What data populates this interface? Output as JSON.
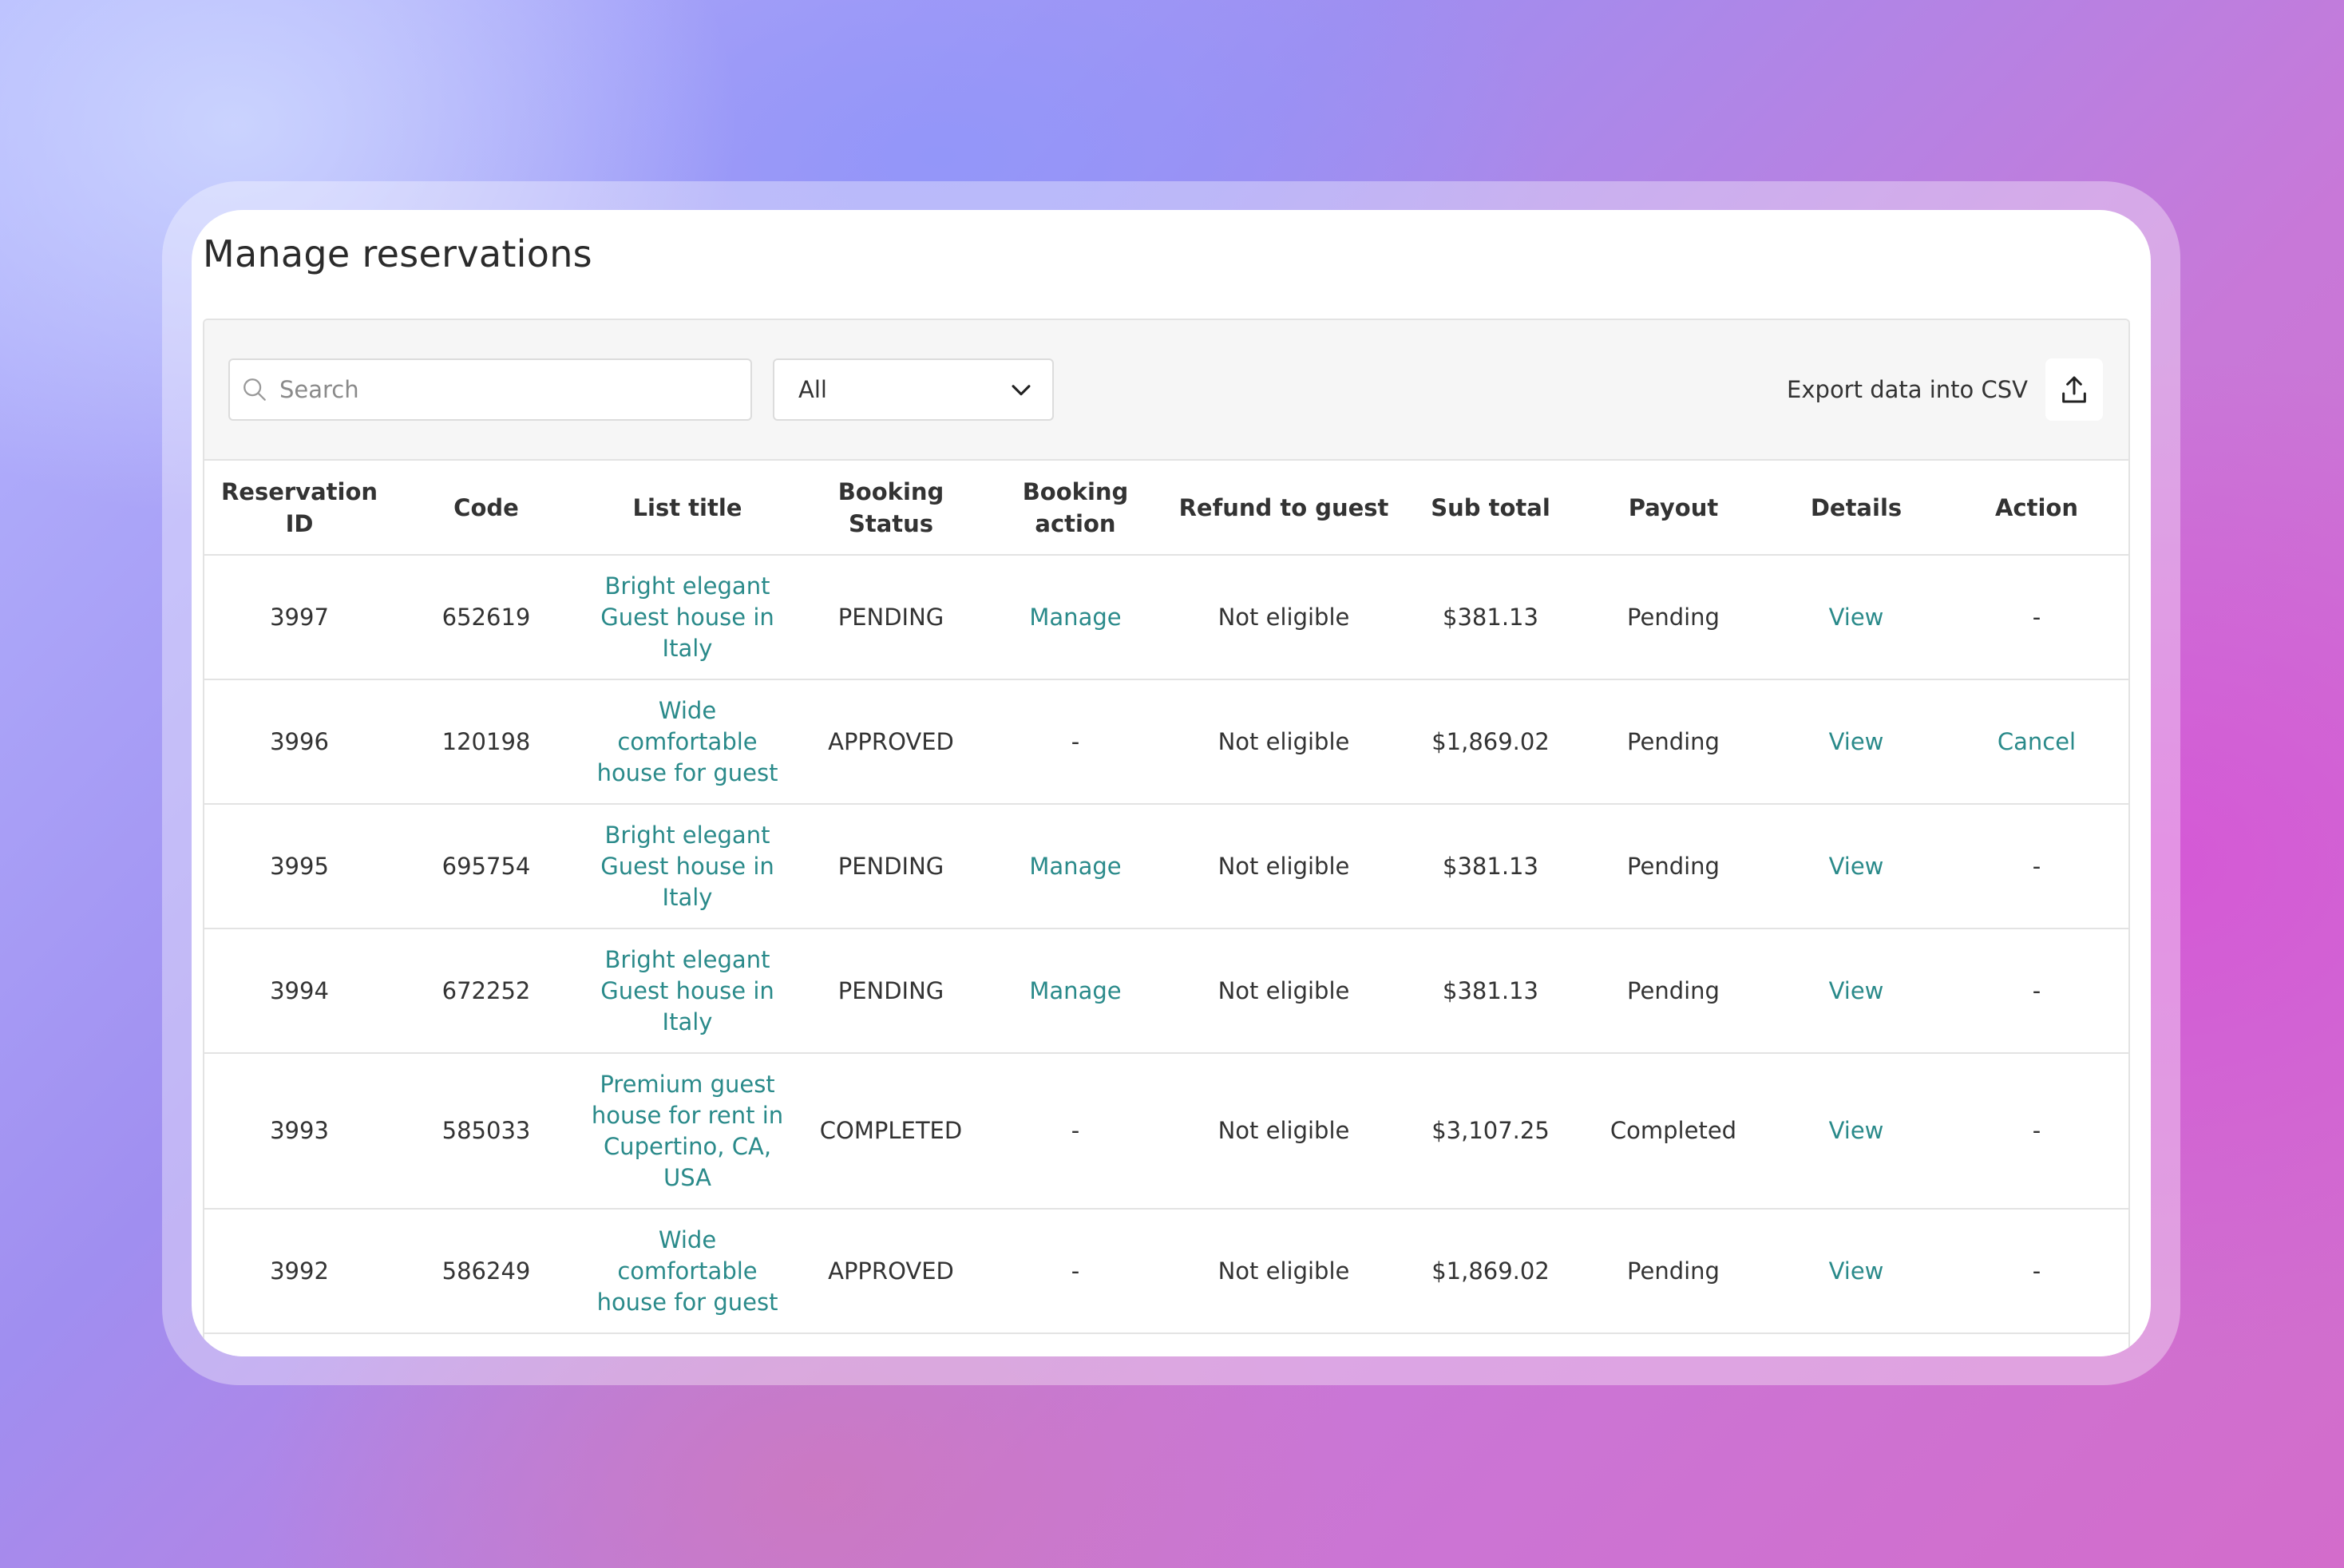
{
  "page": {
    "title": "Manage reservations"
  },
  "toolbar": {
    "search_placeholder": "Search",
    "filter_selected": "All",
    "export_label": "Export data into CSV"
  },
  "table": {
    "headers": {
      "reservation_id": "Reservation ID",
      "code": "Code",
      "list_title": "List title",
      "booking_status": "Booking Status",
      "booking_action": "Booking action",
      "refund": "Refund to guest",
      "subtotal": "Sub total",
      "payout": "Payout",
      "details": "Details",
      "action": "Action"
    },
    "rows": [
      {
        "id": "3997",
        "code": "652619",
        "title": "Bright elegant Guest house in Italy",
        "status": "PENDING",
        "booking_action": "Manage",
        "refund": "Not eligible",
        "subtotal": "$381.13",
        "payout": "Pending",
        "details": "View",
        "action": "-"
      },
      {
        "id": "3996",
        "code": "120198",
        "title": "Wide comfortable house for guest",
        "status": "APPROVED",
        "booking_action": "-",
        "refund": "Not eligible",
        "subtotal": "$1,869.02",
        "payout": "Pending",
        "details": "View",
        "action": "Cancel"
      },
      {
        "id": "3995",
        "code": "695754",
        "title": "Bright elegant Guest house in Italy",
        "status": "PENDING",
        "booking_action": "Manage",
        "refund": "Not eligible",
        "subtotal": "$381.13",
        "payout": "Pending",
        "details": "View",
        "action": "-"
      },
      {
        "id": "3994",
        "code": "672252",
        "title": "Bright elegant Guest house in Italy",
        "status": "PENDING",
        "booking_action": "Manage",
        "refund": "Not eligible",
        "subtotal": "$381.13",
        "payout": "Pending",
        "details": "View",
        "action": "-"
      },
      {
        "id": "3993",
        "code": "585033",
        "title": "Premium guest house for rent in Cupertino, CA, USA",
        "status": "COMPLETED",
        "booking_action": "-",
        "refund": "Not eligible",
        "subtotal": "$3,107.25",
        "payout": "Completed",
        "details": "View",
        "action": "-"
      },
      {
        "id": "3992",
        "code": "586249",
        "title": "Wide comfortable house for guest",
        "status": "APPROVED",
        "booking_action": "-",
        "refund": "Not eligible",
        "subtotal": "$1,869.02",
        "payout": "Pending",
        "details": "View",
        "action": "-"
      }
    ]
  },
  "colors": {
    "link": "#2a8a8a",
    "text": "#333333",
    "border": "#e3e3e3"
  },
  "icons": {
    "search": "search-icon",
    "dropdown": "chevron-down-icon",
    "export": "upload-icon"
  }
}
